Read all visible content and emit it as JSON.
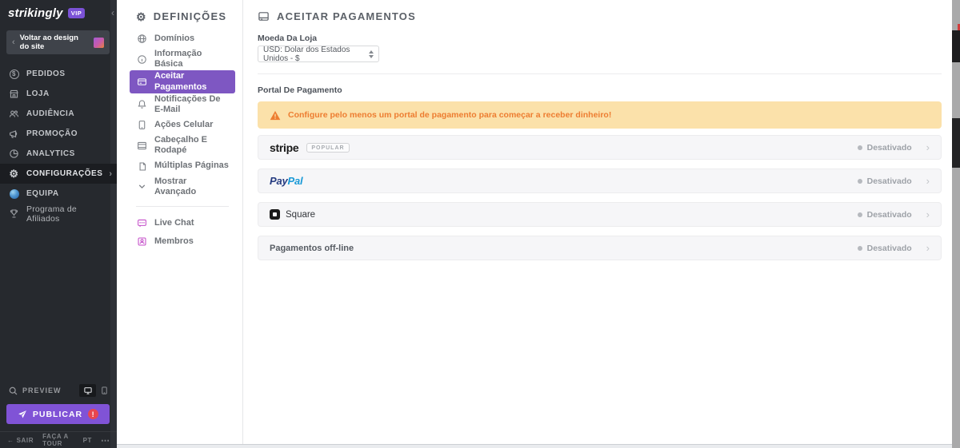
{
  "icons": {
    "chevron_left": "‹",
    "chevron_right": "›",
    "ellipsis": "⋯",
    "back_arrow": "←",
    "gear": "⚙",
    "dollar": "$"
  },
  "sidebar": {
    "logo": "strikingly",
    "vip_badge": "VIP",
    "back_button": "Voltar ao design do site",
    "items": [
      {
        "label": "PEDIDOS",
        "icon": "dollar-circle-icon"
      },
      {
        "label": "LOJA",
        "icon": "storefront-icon"
      },
      {
        "label": "AUDIÊNCIA",
        "icon": "people-icon"
      },
      {
        "label": "PROMOÇÃO",
        "icon": "megaphone-icon"
      },
      {
        "label": "ANALYTICS",
        "icon": "pie-chart-icon"
      },
      {
        "label": "CONFIGURAÇÕES",
        "icon": "gear-icon",
        "active": true
      },
      {
        "label": "EQUIPA",
        "icon": "globe-color-icon"
      },
      {
        "label": "Programa de Afiliados",
        "icon": "trophy-icon"
      }
    ],
    "preview_label": "PREVIEW",
    "publish_label": "PUBLICAR",
    "publish_alert": "!",
    "footer": {
      "exit": "SAIR",
      "tour": "FAÇA A TOUR",
      "language": "PT"
    }
  },
  "settings_panel": {
    "title": "DEFINIÇÕES",
    "items": [
      {
        "label": "Domínios",
        "icon": "globe-icon"
      },
      {
        "label": "Informação Básica",
        "icon": "info-icon"
      },
      {
        "label": "Aceitar Pagamentos",
        "icon": "credit-card-icon",
        "active": true
      },
      {
        "label": "Notificações De E-Mail",
        "icon": "bell-icon"
      },
      {
        "label": "Ações Celular",
        "icon": "mobile-icon"
      },
      {
        "label": "Cabeçalho E Rodapé",
        "icon": "layout-icon"
      },
      {
        "label": "Múltiplas Páginas",
        "icon": "pages-icon"
      },
      {
        "label": "Mostrar Avançado",
        "icon": "chevron-down-icon"
      }
    ],
    "secondary_items": [
      {
        "label": "Live Chat",
        "icon": "chat-icon"
      },
      {
        "label": "Membros",
        "icon": "member-icon"
      }
    ]
  },
  "main": {
    "title": "ACEITAR PAGAMENTOS",
    "currency_label": "Moeda Da Loja",
    "currency_value": "USD: Dolar dos Estados Unidos - $",
    "section_label": "Portal De Pagamento",
    "warning": "Configure pelo menos um portal de pagamento para começar a receber dinheiro!",
    "gateways": [
      {
        "name": "stripe",
        "badge": "POPULAR",
        "status": "Desativado"
      },
      {
        "name": "PayPal",
        "name_part1": "Pay",
        "name_part2": "Pal",
        "status": "Desativado"
      },
      {
        "name": "Square",
        "status": "Desativado"
      },
      {
        "name": "Pagamentos off-line",
        "status": "Desativado"
      }
    ]
  },
  "colors": {
    "sidebar_bg": "#26292e",
    "accent_purple": "#7e57c2",
    "publish_purple": "#8053d6",
    "warning_bg": "#fbe1aa",
    "warning_text": "#ed7d31",
    "paypal_dark_blue": "#253b80",
    "paypal_light_blue": "#1a9ad7",
    "status_gray": "#9ea2a8",
    "alert_red": "#e8464f"
  }
}
